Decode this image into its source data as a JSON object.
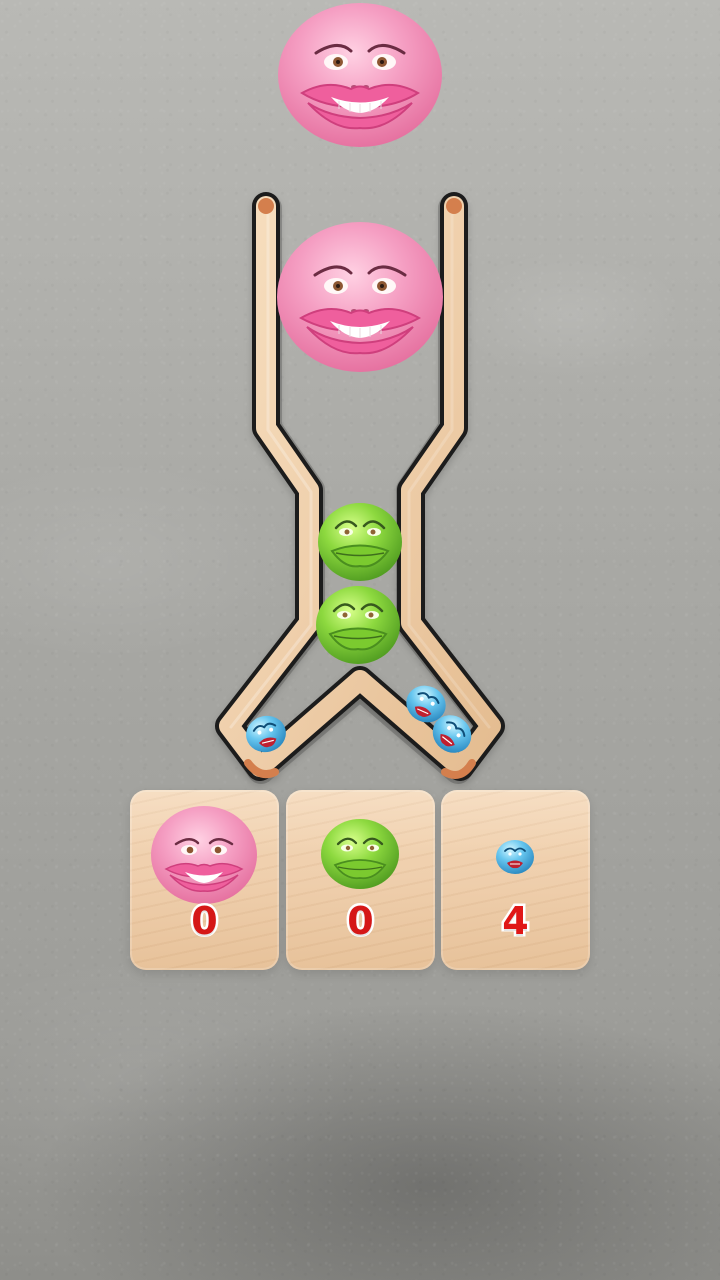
{
  "game": {
    "stage_name": "",
    "hud": {
      "score_cards": [
        {
          "icon": "pink-lips-face-icon",
          "count": "0",
          "color": "#f48fb1"
        },
        {
          "icon": "green-frog-face-icon",
          "count": "0",
          "color": "#7ccf2f"
        },
        {
          "icon": "blue-angry-face-icon",
          "count": "4",
          "color": "#48b6ea"
        }
      ]
    },
    "pieces": {
      "falling": [
        "pink-lips-face-icon",
        "pink-lips-face-icon",
        "green-frog-face-icon",
        "green-frog-face-icon",
        "blue-angry-face-icon",
        "blue-angry-face-icon",
        "blue-angry-face-icon"
      ]
    },
    "colors": {
      "pink": "#f28fb4",
      "green": "#7bca2f",
      "blue": "#4db3e6",
      "wood": "#efcfab",
      "wall": "#a8a8a4",
      "text_red": "#d51717"
    }
  }
}
